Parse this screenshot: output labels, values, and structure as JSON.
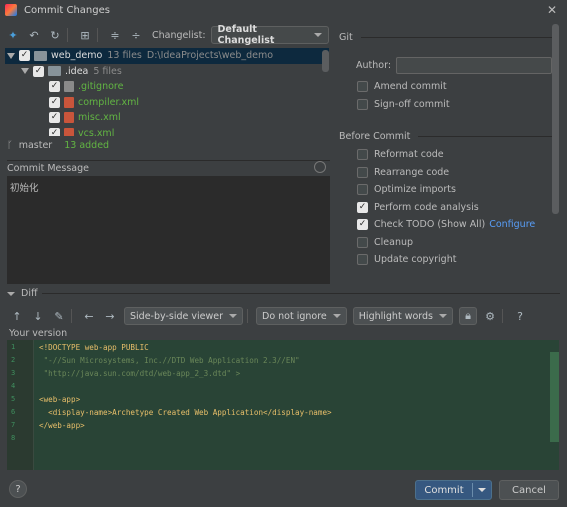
{
  "window": {
    "title": "Commit Changes",
    "close": "✕"
  },
  "toolbar": {
    "changelist_label": "Changelist:",
    "changelist_value": "Default Changelist"
  },
  "tree": {
    "root": {
      "name": "web_demo",
      "count": "13 files",
      "path": "D:\\IdeaProjects\\web_demo"
    },
    "idea": {
      "name": ".idea",
      "count": "5 files"
    },
    "files": [
      ".gitignore",
      "compiler.xml",
      "misc.xml",
      "vcs.xml"
    ]
  },
  "status": {
    "branch": "master",
    "added": "13 added"
  },
  "commit_message": {
    "label": "Commit Message",
    "text": "初始化"
  },
  "git": {
    "title": "Git",
    "author_label": "Author:",
    "author_value": "",
    "amend": "Amend commit",
    "signoff": "Sign-off commit"
  },
  "before_commit": {
    "title": "Before Commit",
    "options": [
      {
        "label": "Reformat code",
        "checked": false
      },
      {
        "label": "Rearrange code",
        "checked": false
      },
      {
        "label": "Optimize imports",
        "checked": false
      },
      {
        "label": "Perform code analysis",
        "checked": true
      },
      {
        "label": "Check TODO (Show All)",
        "checked": true,
        "link": "Configure"
      },
      {
        "label": "Cleanup",
        "checked": false
      },
      {
        "label": "Update copyright",
        "checked": false
      }
    ]
  },
  "diff": {
    "title": "Diff",
    "viewer": "Side-by-side viewer",
    "ignore": "Do not ignore",
    "highlight": "Highlight words",
    "help": "?",
    "version_label": "Your version",
    "line_numbers": [
      "1",
      "2",
      "3",
      "4",
      "5",
      "6",
      "7",
      "8"
    ],
    "lines": [
      "<!DOCTYPE web-app PUBLIC",
      " \"-//Sun Microsystems, Inc.//DTD Web Application 2.3//EN\"",
      " \"http://java.sun.com/dtd/web-app_2_3.dtd\" >",
      "",
      "<web-app>",
      "  <display-name>Archetype Created Web Application</display-name>",
      "</web-app>",
      ""
    ]
  },
  "footer": {
    "help": "?",
    "commit": "Commit",
    "cancel": "Cancel"
  }
}
